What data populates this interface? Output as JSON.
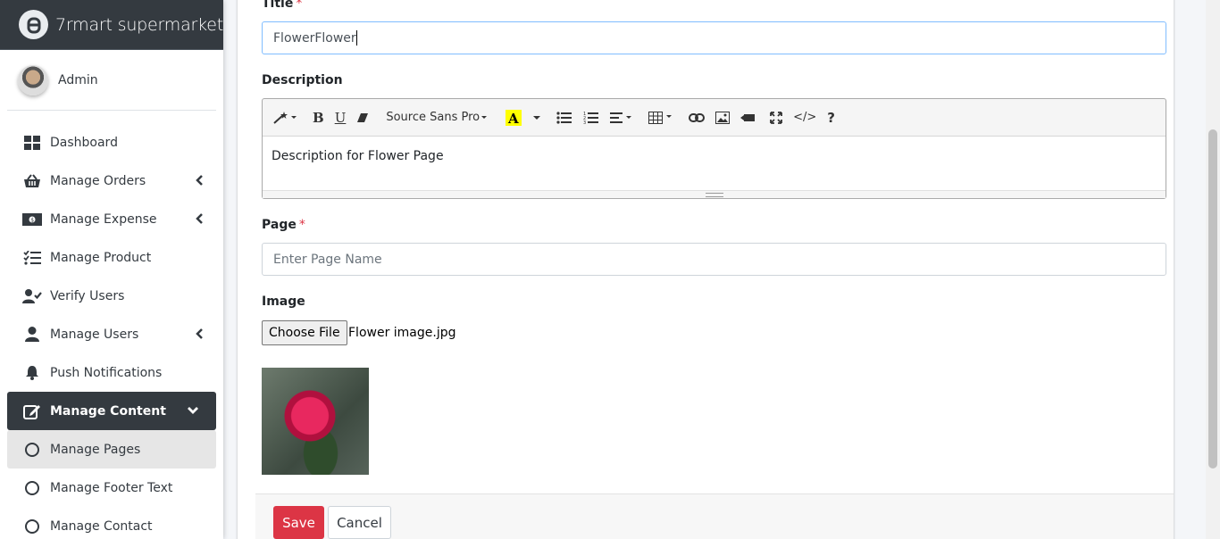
{
  "app": {
    "brand": "7rmart supermarket",
    "user": "Admin"
  },
  "sidebar": {
    "items": [
      {
        "label": "Dashboard",
        "icon": "dashboard-icon"
      },
      {
        "label": "Manage Orders",
        "icon": "basket-icon"
      },
      {
        "label": "Manage Expense",
        "icon": "money-icon"
      },
      {
        "label": "Manage Product",
        "icon": "tasks-icon"
      },
      {
        "label": "Verify Users",
        "icon": "user-check-icon"
      },
      {
        "label": "Manage Users",
        "icon": "user-icon"
      },
      {
        "label": "Push Notifications",
        "icon": "bell-icon"
      },
      {
        "label": "Manage Content",
        "icon": "edit-icon"
      },
      {
        "label": "Manage Pages",
        "icon": "circle-icon"
      },
      {
        "label": "Manage Footer Text",
        "icon": "circle-icon"
      },
      {
        "label": "Manage Contact",
        "icon": "circle-icon"
      }
    ]
  },
  "form": {
    "title_label": "Title",
    "title_value": "FlowerFlower",
    "description_label": "Description",
    "editor_font": "Source Sans Pro",
    "description_value": "Description for Flower Page",
    "page_label": "Page",
    "page_placeholder": "Enter Page Name",
    "image_label": "Image",
    "choose_file": "Choose File",
    "file_name": "Flower image.jpg",
    "required_mark": "*"
  },
  "footer": {
    "save_label": "Save",
    "cancel_label": "Cancel"
  },
  "colors": {
    "sidebar_dark": "#343a40",
    "danger": "#dc3545",
    "focus_border": "#80bdff"
  }
}
